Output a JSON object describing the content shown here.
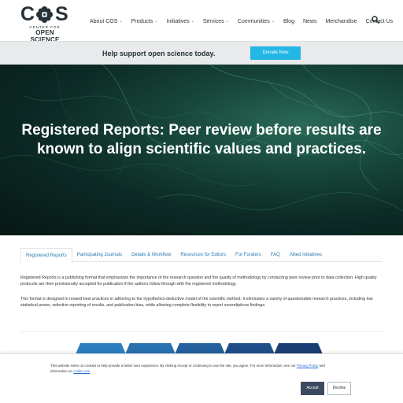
{
  "logo": {
    "letter_c": "C",
    "letter_s": "S",
    "line1": "CENTER FOR",
    "line2": "OPEN SCIENCE"
  },
  "nav": {
    "items": [
      {
        "label": "About COS",
        "dropdown": true
      },
      {
        "label": "Products",
        "dropdown": true
      },
      {
        "label": "Initiatives",
        "dropdown": true
      },
      {
        "label": "Services",
        "dropdown": true
      },
      {
        "label": "Communities",
        "dropdown": true
      },
      {
        "label": "Blog",
        "dropdown": false
      },
      {
        "label": "News",
        "dropdown": false
      },
      {
        "label": "Merchandise",
        "dropdown": false
      },
      {
        "label": "Contact Us",
        "dropdown": false
      }
    ],
    "caret": "⌄",
    "search_icon": "search-icon"
  },
  "donate": {
    "text": "Help support open science today.",
    "button": "Donate Now",
    "button_color": "#23b7e5"
  },
  "hero": {
    "title": "Registered Reports: Peer review before results are known to align scientific values and practices."
  },
  "tabs": [
    {
      "label": "Registered Reports",
      "active": true
    },
    {
      "label": "Participating Journals",
      "active": false
    },
    {
      "label": "Details & Workflow",
      "active": false
    },
    {
      "label": "Resources for Editors",
      "active": false
    },
    {
      "label": "For Funders",
      "active": false
    },
    {
      "label": "FAQ",
      "active": false
    },
    {
      "label": "Allied Initiatives",
      "active": false
    }
  ],
  "content": {
    "p1": "Registered Reports is a publishing format that emphasizes the importance of the research question and the quality of methodology by conducting peer review prior to data collection. High quality protocols are then provisionally accepted for publication if the authors follow through with the registered methodology.",
    "p2": "This format is designed to reward best practices in adhering to the hypothetico-deductive model of the scientific method. It eliminates a variety of questionable research practices, including low statistical power, selective reporting of results, and publication bias, while allowing complete flexibility to report serendipitous findings."
  },
  "process_colors": [
    "#2b7fc0",
    "#2870b0",
    "#24609e",
    "#1f4e8a",
    "#1b3f75"
  ],
  "cookie": {
    "text": "This website relies on cookies to help provide a better user experience. By clicking Accept or continuing to use the site, you agree. For more information, see our",
    "privacy_link": "Privacy Policy",
    "and": "and",
    "information_on": "information on",
    "cookie_link": "cookie use",
    "accept": "Accept",
    "decline": "Decline"
  }
}
